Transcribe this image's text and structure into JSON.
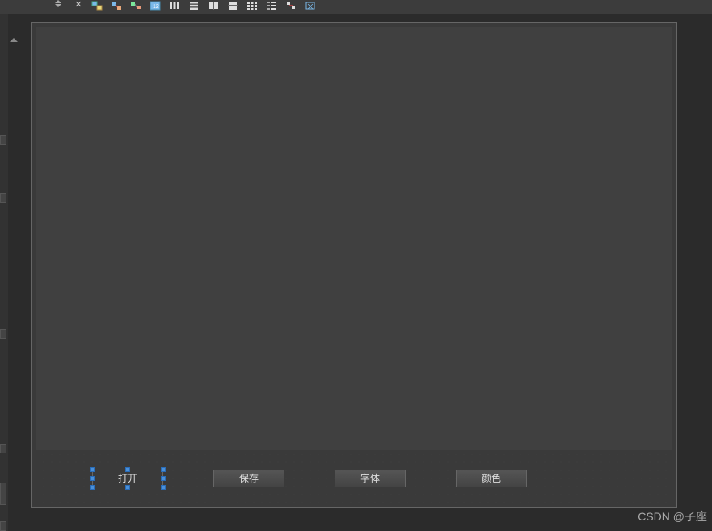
{
  "toolbar": {
    "icons": [
      "edit-widgets-icon",
      "edit-signals-icon",
      "edit-buddies-icon",
      "edit-tab-order-icon",
      "layout-horizontal-icon",
      "layout-vertical-icon",
      "layout-horizontal-splitter-icon",
      "layout-vertical-splitter-icon",
      "layout-grid-icon",
      "layout-form-icon",
      "break-layout-icon",
      "adjust-size-icon"
    ]
  },
  "canvas": {
    "buttons": {
      "open": "打开",
      "save": "保存",
      "font": "字体",
      "color": "颜色"
    },
    "selected_button": "open"
  },
  "watermark": "CSDN @子座",
  "colors": {
    "background": "#2b2b2b",
    "canvas": "#404040",
    "frame": "#3a3a3a",
    "selection_handle": "#4a90d9"
  }
}
